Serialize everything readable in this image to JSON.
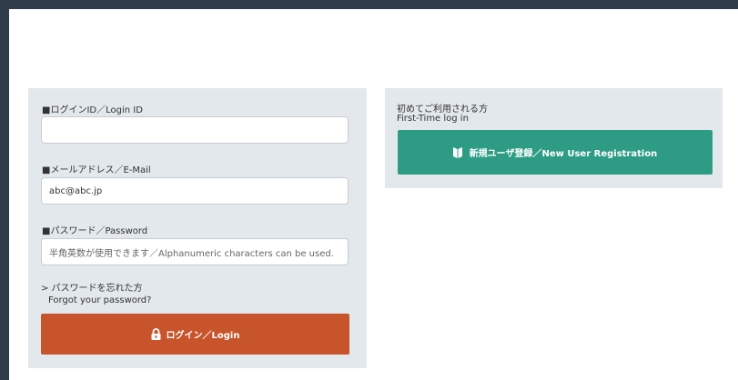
{
  "login": {
    "login_id_label": "■ログインID／Login ID",
    "login_id_value": "",
    "email_label": "■メールアドレス／E-Mail",
    "email_value": "abc@abc.jp",
    "password_label": "■パスワード／Password",
    "password_placeholder": "半角英数が使用できます／Alphanumeric characters can be used.",
    "forgot_jp": "> パスワードを忘れた方",
    "forgot_en": "Forgot your password?",
    "login_button": "ログイン／Login",
    "button_color": "#c8542b"
  },
  "registration": {
    "heading_jp": "初めてご利用される方",
    "heading_en": "First-Time log in",
    "register_button": "新規ユーザ登録／New User Registration",
    "button_color": "#2e9c85"
  },
  "icons": {
    "login_button_icon": "lock-icon",
    "register_button_icon": "beginner-mark-icon"
  }
}
